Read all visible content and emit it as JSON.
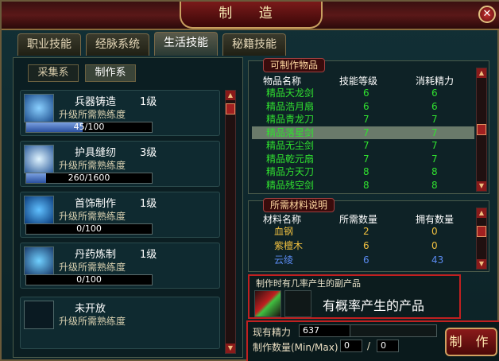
{
  "window": {
    "title": "制 造",
    "close_label": "✕"
  },
  "tabs": [
    {
      "label": "职业技能",
      "active": false
    },
    {
      "label": "经脉系统",
      "active": false
    },
    {
      "label": "生活技能",
      "active": true
    },
    {
      "label": "秘籍技能",
      "active": false
    }
  ],
  "subtabs": [
    {
      "label": "采集系",
      "active": false
    },
    {
      "label": "制作系",
      "active": true
    }
  ],
  "skills": [
    {
      "name": "兵器铸造",
      "level": "1级",
      "hint": "升级所需熟练度",
      "progress": "45/100",
      "fraction": 0.45,
      "icon": "weapon-forging-icon"
    },
    {
      "name": "护具缝纫",
      "level": "3级",
      "hint": "升级所需熟练度",
      "progress": "260/1600",
      "fraction": 0.1625,
      "icon": "armor-sewing-icon"
    },
    {
      "name": "首饰制作",
      "level": "1级",
      "hint": "升级所需熟练度",
      "progress": "0/100",
      "fraction": 0,
      "icon": "jewelry-crafting-icon"
    },
    {
      "name": "丹药炼制",
      "level": "1级",
      "hint": "升级所需熟练度",
      "progress": "0/100",
      "fraction": 0,
      "icon": "alchemy-icon"
    },
    {
      "name": "未开放",
      "level": "",
      "hint": "升级所需熟练度",
      "progress": "",
      "fraction": 0,
      "icon": "locked-slot-icon"
    }
  ],
  "items_panel": {
    "label": "可制作物品",
    "headers": [
      "物品名称",
      "技能等级",
      "消耗精力"
    ],
    "rows": [
      {
        "name": "精品天龙剑",
        "level": "6",
        "cost": "6",
        "selected": false
      },
      {
        "name": "精品浩月扇",
        "level": "6",
        "cost": "6",
        "selected": false
      },
      {
        "name": "精品青龙刀",
        "level": "7",
        "cost": "7",
        "selected": false
      },
      {
        "name": "精品落星剑",
        "level": "7",
        "cost": "7",
        "selected": true
      },
      {
        "name": "精品无尘剑",
        "level": "7",
        "cost": "7",
        "selected": false
      },
      {
        "name": "精品乾元扇",
        "level": "7",
        "cost": "7",
        "selected": false
      },
      {
        "name": "精品方天刀",
        "level": "8",
        "cost": "8",
        "selected": false
      },
      {
        "name": "精品残空剑",
        "level": "8",
        "cost": "8",
        "selected": false
      }
    ]
  },
  "materials_panel": {
    "label": "所需材料说明",
    "headers": [
      "材料名称",
      "所需数量",
      "拥有数量"
    ],
    "rows": [
      {
        "name": "血钢",
        "need": "2",
        "have": "0",
        "color": "#f0c040"
      },
      {
        "name": "紫檀木",
        "need": "6",
        "have": "0",
        "color": "#f0c040"
      },
      {
        "name": "云绫",
        "need": "6",
        "have": "43",
        "color": "#5a8af0"
      }
    ]
  },
  "byproduct": {
    "label": "制作时有几率产生的副产品",
    "text": "有概率产生的产品"
  },
  "energy": {
    "label": "现有精力",
    "value": "637"
  },
  "quantity": {
    "label": "制作数量(Min/Max)",
    "min": "0",
    "separator": "/",
    "max": "0"
  },
  "make_button": "制 作",
  "colors": {
    "item_text": "#30e030",
    "selected_bg": "#6a7a6a",
    "accent_red": "#c02020"
  }
}
